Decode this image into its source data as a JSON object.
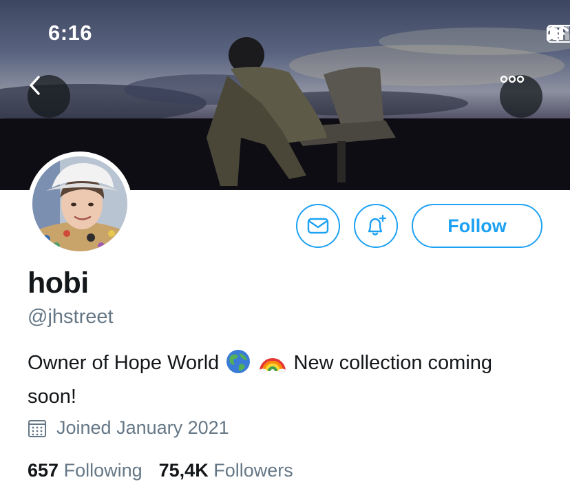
{
  "status_bar": {
    "time": "6:16"
  },
  "profile": {
    "display_name": "hobi",
    "handle": "@jhstreet",
    "bio_part1": "Owner of Hope World",
    "bio_part2": "New collection coming soon!",
    "joined": "Joined January 2021",
    "following_count": "657",
    "following_label": "Following",
    "followers_count": "75,4K",
    "followers_label": "Followers"
  },
  "actions": {
    "follow_label": "Follow"
  },
  "icons": {
    "back": "chevron-left-icon",
    "more": "more-horizontal-icon",
    "message": "mail-icon",
    "notify": "bell-plus-icon",
    "calendar": "calendar-icon",
    "globe_emoji": "globe-emoji",
    "rainbow_emoji": "rainbow-emoji"
  },
  "colors": {
    "accent": "#1da1f2",
    "text_primary": "#14171a",
    "text_secondary": "#657786"
  }
}
